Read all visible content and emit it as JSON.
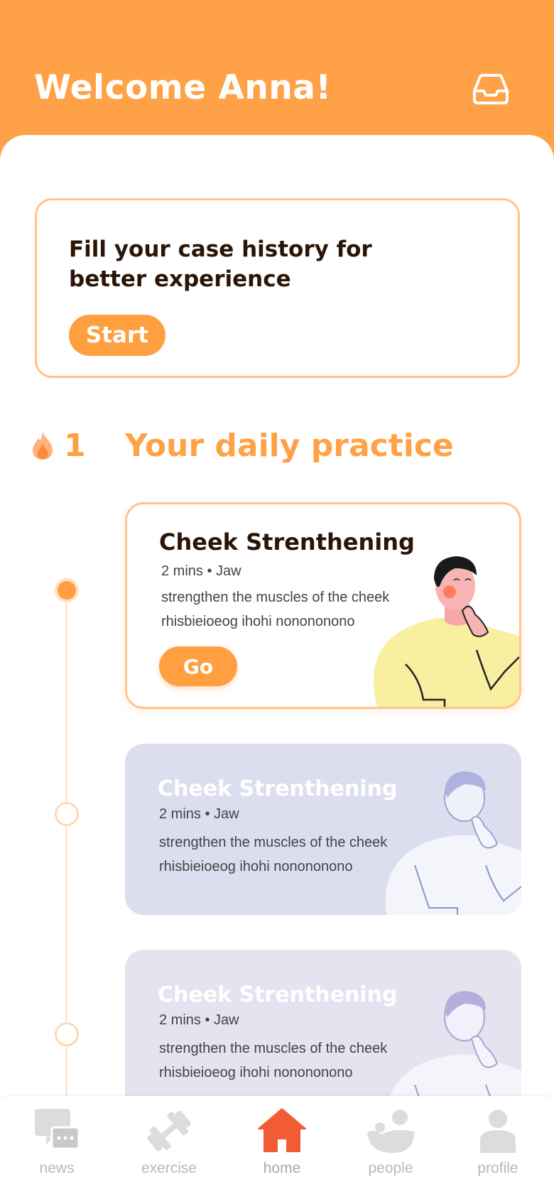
{
  "header": {
    "title": "Welcome Anna!",
    "inbox_icon": "inbox-icon"
  },
  "case_history": {
    "text": "Fill your case history for better experience",
    "button": "Start"
  },
  "streak": {
    "count": "1",
    "icon": "flame-icon",
    "title": "Your daily practice"
  },
  "exercises": [
    {
      "name": "Cheek Strenthening",
      "duration": "2 mins",
      "category": "Jaw",
      "description": "strengthen the muscles of the cheek rhisbieioeog ihohi nonononono",
      "button": "Go",
      "status": "active"
    },
    {
      "name": "Cheek Strenthening",
      "duration": "2 mins",
      "category": "Jaw",
      "description": "strengthen the muscles of the cheek rhisbieioeog ihohi nonononono",
      "status": "locked"
    },
    {
      "name": "Cheek Strenthening",
      "duration": "2 mins",
      "category": "Jaw",
      "description": "strengthen the muscles of the cheek rhisbieioeog ihohi nonononono",
      "status": "locked"
    }
  ],
  "tabs": [
    {
      "label": "news",
      "icon": "chat-icon"
    },
    {
      "label": "exercise",
      "icon": "dumbbell-icon"
    },
    {
      "label": "home",
      "icon": "home-icon",
      "active": true
    },
    {
      "label": "people",
      "icon": "people-icon"
    },
    {
      "label": "profile",
      "icon": "profile-icon"
    }
  ],
  "colors": {
    "primary": "#ffa247",
    "accent": "#ff9f40",
    "home_active": "#f25c35",
    "card_locked_1": "#dcdef0",
    "card_locked_2": "#e6e2f0"
  }
}
